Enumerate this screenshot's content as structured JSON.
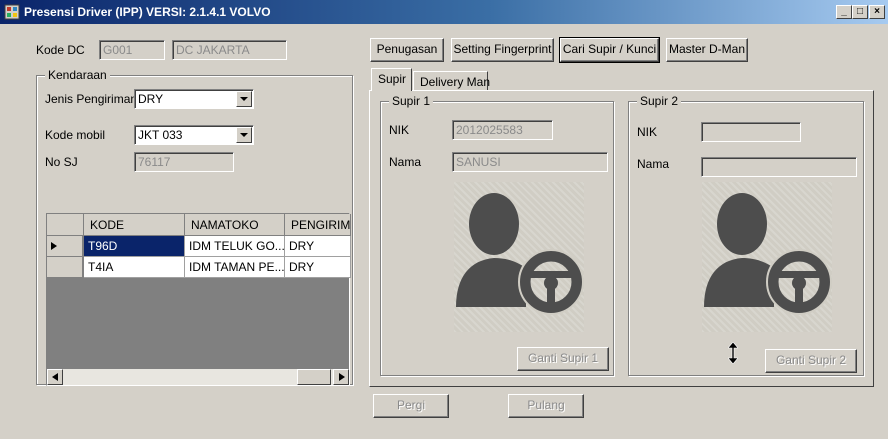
{
  "window": {
    "title": "Presensi Driver (IPP) VERSI: 2.1.4.1 VOLVO",
    "minimize": "_",
    "maximize": "□",
    "close": "×"
  },
  "kode_dc": {
    "label": "Kode DC",
    "code": "G001",
    "name": "DC JAKARTA"
  },
  "kendaraan": {
    "title": "Kendaraan",
    "jenis_label": "Jenis Pengiriman",
    "jenis_value": "DRY",
    "kode_mobil_label": "Kode mobil",
    "kode_mobil_value": "JKT 033",
    "no_sj_label": "No SJ",
    "no_sj_value": "76117"
  },
  "grid": {
    "columns": [
      "KODE",
      "NAMATOKO",
      "PENGIRIMA"
    ],
    "rows": [
      {
        "kode": "T96D",
        "namatoko": "IDM TELUK GO...",
        "pengiriman": "DRY",
        "selected": true
      },
      {
        "kode": "T4IA",
        "namatoko": "IDM TAMAN PE...",
        "pengiriman": "DRY",
        "selected": false
      }
    ]
  },
  "toolbar": {
    "penugasan": "Penugasan",
    "setting_fingerprint": "Setting Fingerprint",
    "cari_supir": "Cari Supir / Kunci",
    "master_dman": "Master D-Man"
  },
  "tabs": [
    "Supir",
    "Delivery Man"
  ],
  "supir1": {
    "title": "Supir 1",
    "nik_label": "NIK",
    "nik_value": "2012025583",
    "nama_label": "Nama",
    "nama_value": "SANUSI",
    "button": "Ganti Supir 1"
  },
  "supir2": {
    "title": "Supir 2",
    "nik_label": "NIK",
    "nik_value": "",
    "nama_label": "Nama",
    "nama_value": "",
    "button": "Ganti Supir 2"
  },
  "actions": {
    "pergi": "Pergi",
    "pulang": "Pulang"
  },
  "colors": {
    "face": "#d4d0c8",
    "selection": "#0a246a",
    "driver_icon": "#4d4d4d"
  }
}
